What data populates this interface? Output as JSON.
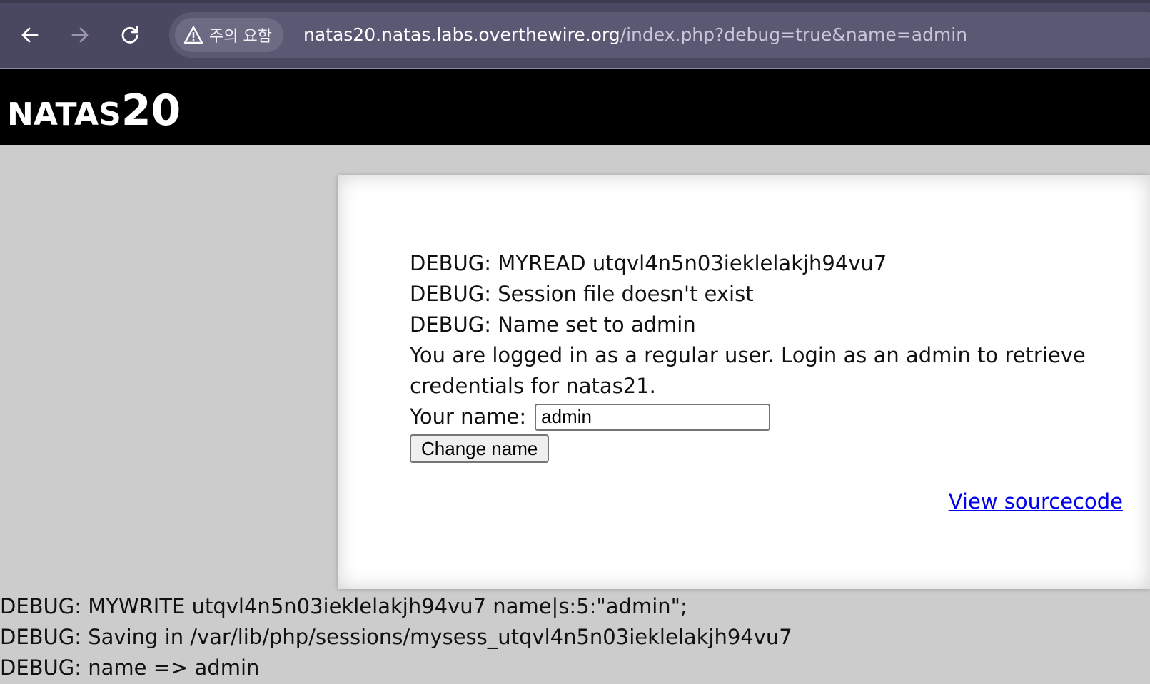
{
  "browser": {
    "security_label": "주의 요함",
    "url_host": "natas20.natas.labs.overthewire.org",
    "url_path": "/index.php?debug=true&name=admin",
    "icons": {
      "back": "back-arrow-icon",
      "forward": "forward-arrow-icon",
      "reload": "reload-icon",
      "warning": "warning-triangle-icon"
    }
  },
  "header": {
    "title_prefix": "NATAS",
    "title_number": "20"
  },
  "content": {
    "debug_lines": [
      "DEBUG: MYREAD utqvl4n5n03ieklelakjh94vu7",
      "DEBUG: Session file doesn't exist",
      "DEBUG: Name set to admin"
    ],
    "message": "You are logged in as a regular user. Login as an admin to retrieve credentials for natas21.",
    "name_label": "Your name:",
    "name_value": "admin",
    "submit_label": "Change name",
    "source_link": "View sourcecode"
  },
  "footer": {
    "debug_lines": [
      "DEBUG: MYWRITE utqvl4n5n03ieklelakjh94vu7 name|s:5:\"admin\";",
      "DEBUG: Saving in /var/lib/php/sessions/mysess_utqvl4n5n03ieklelakjh94vu7",
      "DEBUG: name => admin"
    ]
  }
}
